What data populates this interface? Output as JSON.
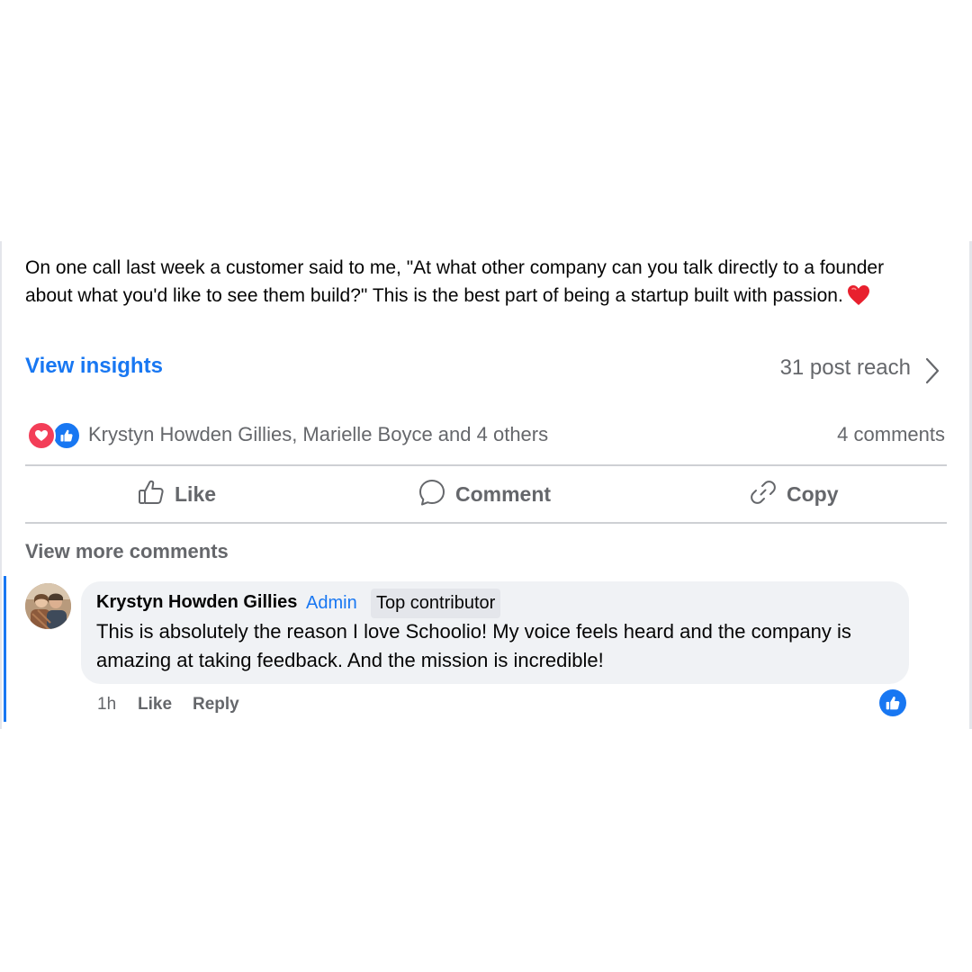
{
  "post": {
    "text": "On one call last week a customer said to me, \"At what other company can you talk directly to a founder about what you'd like to see them build?\" This is the best part of being a startup built with passion.",
    "emoji": "heart-emoji",
    "insights_label": "View insights",
    "reach_label": "31 post reach"
  },
  "reactions": {
    "icons": [
      "love-reaction-icon",
      "like-reaction-icon"
    ],
    "names": "Krystyn Howden Gillies, Marielle Boyce and 4 others",
    "comments_count": "4 comments"
  },
  "actions": {
    "like": "Like",
    "comment": "Comment",
    "copy": "Copy"
  },
  "comments": {
    "view_more": "View more comments",
    "items": [
      {
        "author": "Krystyn Howden Gillies",
        "role": "Admin",
        "badge": "Top contributor",
        "text": "This is absolutely the reason I love Schoolio! My voice feels heard and the company is amazing at taking feedback. And the mission is incredible!",
        "time": "1h",
        "like_label": "Like",
        "reply_label": "Reply",
        "reaction": "like-reaction-icon"
      }
    ]
  },
  "colors": {
    "accent": "#1877f2",
    "love": "#f33e58",
    "secondary_text": "#65676b",
    "bubble": "#f0f2f5",
    "divider": "#ced0d4"
  }
}
